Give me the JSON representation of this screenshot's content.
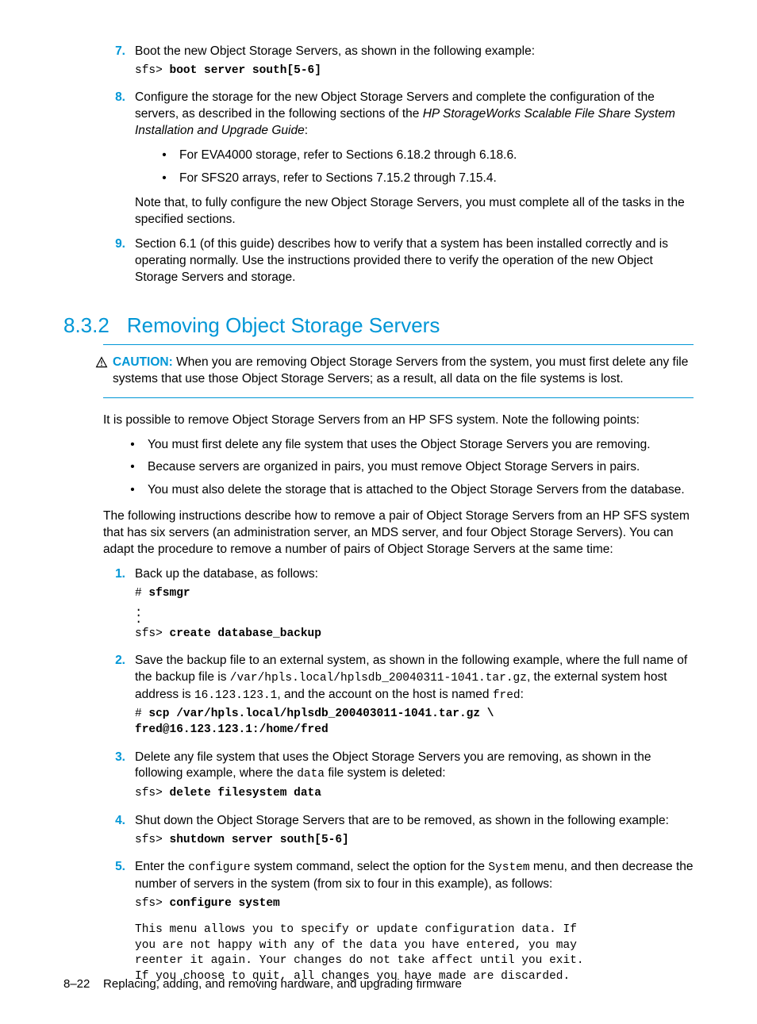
{
  "ol": {
    "n7": "7.",
    "n8": "8.",
    "n9": "9.",
    "n1": "1.",
    "n2": "2.",
    "n3": "3.",
    "n4": "4.",
    "n5": "5."
  },
  "step7": {
    "text": "Boot the new Object Storage Servers, as shown in the following example:",
    "code_prompt": "sfs>",
    "code_cmd": " boot server south[5-6]"
  },
  "step8": {
    "p1a": "Configure the storage for the new Object Storage Servers and complete the configuration of the servers, as described in the following sections of the ",
    "p1_em": "HP StorageWorks Scalable File Share System Installation and Upgrade Guide",
    "p1b": ":",
    "b1": "For EVA4000 storage, refer to Sections 6.18.2 through 6.18.6.",
    "b2": "For SFS20 arrays, refer to Sections 7.15.2 through 7.15.4.",
    "note": "Note that, to fully configure the new Object Storage Servers, you must complete all of the tasks in the specified sections."
  },
  "step9": {
    "text": "Section 6.1 (of this guide) describes how to verify that a system has been installed correctly and is operating normally. Use the instructions provided there to verify the operation of the new Object Storage Servers and storage."
  },
  "section": {
    "num": "8.3.2",
    "title": "Removing Object Storage Servers"
  },
  "caution": {
    "label": "CAUTION:",
    "text": " When you are removing Object Storage Servers from the system, you must first delete any file systems that use those Object Storage Servers; as a result, all data on the file systems is lost."
  },
  "intro": "It is possible to remove Object Storage Servers from an HP SFS system. Note the following points:",
  "pts": {
    "b1": "You must first delete any file system that uses the Object Storage Servers you are removing.",
    "b2": "Because servers are organized in pairs, you must remove Object Storage Servers in pairs.",
    "b3": "You must also delete the storage that is attached to the Object Storage Servers from the database."
  },
  "instr": "The following instructions describe how to remove a pair of Object Storage Servers from an HP SFS system that has six servers (an administration server, an MDS server, and four Object Storage Servers). You can adapt the procedure to remove a number of pairs of Object Storage Servers at the same time:",
  "r1": {
    "text": "Back up the database, as follows:",
    "c1a": "# ",
    "c1b": "sfsmgr",
    "c2a": "sfs>",
    "c2b": " create database_backup"
  },
  "r2": {
    "t1": "Save the backup file to an external system, as shown in the following example, where the full name of the backup file is ",
    "m1": "/var/hpls.local/hplsdb_20040311-1041.tar.gz",
    "t2": ", the external system host address is ",
    "m2": "16.123.123.1",
    "t3": ", and the account on the host is named ",
    "m3": "fred",
    "t4": ":",
    "c_hash": "# ",
    "c_cmd": "scp /var/hpls.local/hplsdb_200403011-1041.tar.gz \\\nfred@16.123.123.1:/home/fred"
  },
  "r3": {
    "t1": "Delete any file system that uses the Object Storage Servers you are removing, as shown in the following example, where the ",
    "m1": "data",
    "t2": " file system is deleted:",
    "ca": "sfs>",
    "cb": " delete filesystem data"
  },
  "r4": {
    "text": "Shut down the Object Storage Servers that are to be removed, as shown in the following example:",
    "ca": "sfs>",
    "cb": " shutdown server south[5-6]"
  },
  "r5": {
    "t1": "Enter the ",
    "m1": "configure",
    "t2": " system command, select the option for the ",
    "m2": "System",
    "t3": " menu, and then decrease the number of servers in the system (from six to four in this example), as follows:",
    "ca": "sfs>",
    "cb": " configure system",
    "out": "This menu allows you to specify or update configuration data. If\nyou are not happy with any of the data you have entered, you may\nreenter it again. Your changes do not take affect until you exit.\nIf you choose to quit, all changes you have made are discarded."
  },
  "footer": {
    "pg": "8–22",
    "txt": "Replacing, adding, and removing hardware, and upgrading firmware"
  }
}
